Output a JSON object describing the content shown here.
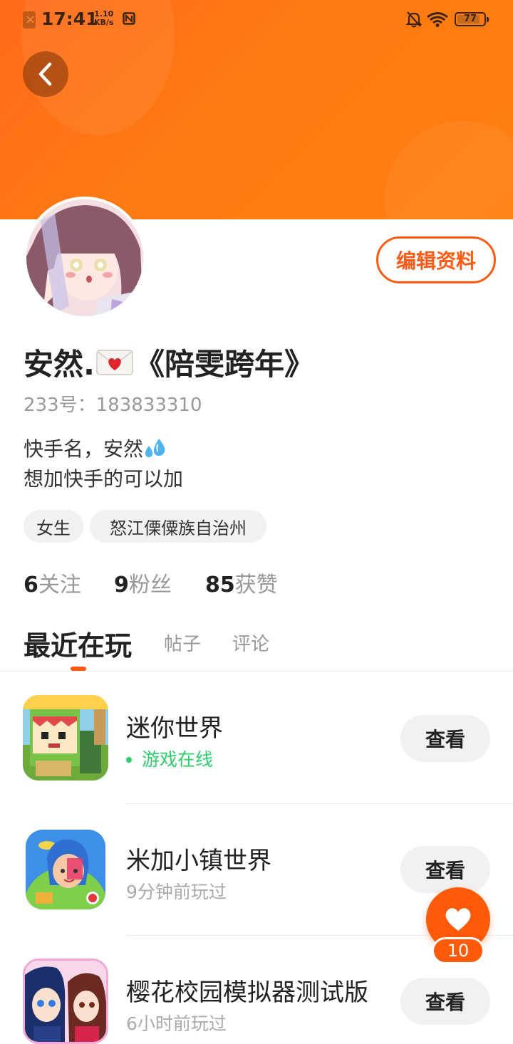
{
  "status_bar": {
    "time": "17:41",
    "net_speed_value": "1.10",
    "net_speed_unit": "KB/s",
    "battery": "77",
    "icons": [
      "sim-error-icon",
      "nfc-icon",
      "mute-icon",
      "wifi-icon",
      "battery-icon"
    ]
  },
  "header": {
    "back_icon": "chevron-left-icon",
    "edit_profile_label": "编辑资料"
  },
  "profile": {
    "name_prefix": "安然.",
    "name_emoji": "love-letter-icon",
    "name_suffix": "《陪雯跨年》",
    "id_label": "233号：183833310",
    "bio_line1": "快手名，安然",
    "bio_emoji": "sweat-droplets-icon",
    "bio_line2": "想加快手的可以加",
    "tags": [
      "女生",
      "怒江傈僳族自治州"
    ],
    "stats": {
      "following_count": "6",
      "following_label": "关注",
      "fans_count": "9",
      "fans_label": "粉丝",
      "likes_count": "85",
      "likes_label": "获赞"
    }
  },
  "tabs": [
    {
      "label": "最近在玩",
      "active": true
    },
    {
      "label": "帖子",
      "active": false
    },
    {
      "label": "评论",
      "active": false
    }
  ],
  "games": [
    {
      "name": "迷你世界",
      "status": "游戏在线",
      "online": true,
      "button": "查看"
    },
    {
      "name": "米加小镇世界",
      "status": "9分钟前玩过",
      "online": false,
      "button": "查看"
    },
    {
      "name": "樱花校园模拟器测试版",
      "status": "6小时前玩过",
      "online": false,
      "button": "查看"
    }
  ],
  "like_fab": {
    "icon": "heart-icon",
    "count": "10"
  },
  "colors": {
    "accent": "#ff5a14",
    "header_gradient_start": "#ff6a1a",
    "header_gradient_end": "#ff7f0f",
    "online": "#2ecf6b"
  }
}
